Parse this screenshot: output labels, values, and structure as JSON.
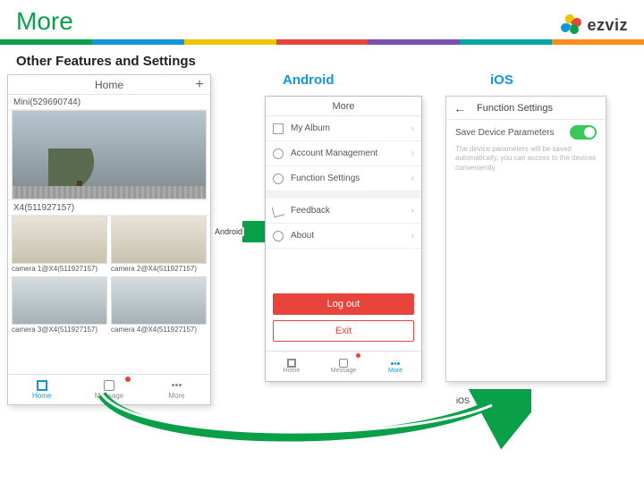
{
  "header": {
    "title": "More",
    "logo": "ezviz"
  },
  "subhead": "Other Features and Settings",
  "columns": {
    "android": "Android",
    "ios": "iOS"
  },
  "arrows": {
    "android_label": "Android",
    "ios_label": "iOS"
  },
  "phone_home": {
    "title": "Home",
    "cam1": "Mini(529690744)",
    "cam2": "X4(511927157)",
    "sub1": "camera 1@X4(511927157)",
    "sub2": "camera 2@X4(511927157)",
    "sub3": "camera 3@X4(511927157)",
    "sub4": "camera 4@X4(511927157)",
    "tabs": {
      "home": "Home",
      "message": "Message",
      "more": "More"
    }
  },
  "phone_more": {
    "title": "More",
    "items": {
      "album": "My Album",
      "account": "Account Management",
      "func": "Function Settings",
      "feedback": "Feedback",
      "about": "About"
    },
    "logout": "Log out",
    "exit": "Exit",
    "tabs": {
      "home": "Home",
      "message": "Message",
      "more": "More"
    }
  },
  "phone_ios": {
    "title": "Function Settings",
    "toggle_label": "Save Device Parameters",
    "desc": "The device parameters will be saved automatically, you can access to the devices conveniently."
  }
}
